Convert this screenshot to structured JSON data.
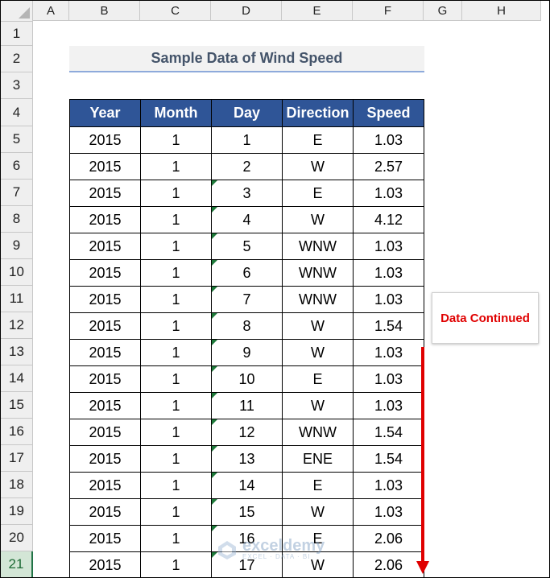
{
  "columns": [
    "A",
    "B",
    "C",
    "D",
    "E",
    "F",
    "G",
    "H"
  ],
  "rows": [
    "1",
    "2",
    "3",
    "4",
    "5",
    "6",
    "7",
    "8",
    "9",
    "10",
    "11",
    "12",
    "13",
    "14",
    "15",
    "16",
    "17",
    "18",
    "19",
    "20",
    "21"
  ],
  "active_row": "21",
  "title": "Sample Data of Wind Speed",
  "table": {
    "headers": [
      "Year",
      "Month",
      "Day",
      "Direction",
      "Speed"
    ],
    "rows": [
      [
        "2015",
        "1",
        "1",
        "E",
        "1.03"
      ],
      [
        "2015",
        "1",
        "2",
        "W",
        "2.57"
      ],
      [
        "2015",
        "1",
        "3",
        "E",
        "1.03"
      ],
      [
        "2015",
        "1",
        "4",
        "W",
        "4.12"
      ],
      [
        "2015",
        "1",
        "5",
        "WNW",
        "1.03"
      ],
      [
        "2015",
        "1",
        "6",
        "WNW",
        "1.03"
      ],
      [
        "2015",
        "1",
        "7",
        "WNW",
        "1.03"
      ],
      [
        "2015",
        "1",
        "8",
        "W",
        "1.54"
      ],
      [
        "2015",
        "1",
        "9",
        "W",
        "1.03"
      ],
      [
        "2015",
        "1",
        "10",
        "E",
        "1.03"
      ],
      [
        "2015",
        "1",
        "11",
        "W",
        "1.03"
      ],
      [
        "2015",
        "1",
        "12",
        "WNW",
        "1.54"
      ],
      [
        "2015",
        "1",
        "13",
        "ENE",
        "1.54"
      ],
      [
        "2015",
        "1",
        "14",
        "E",
        "1.03"
      ],
      [
        "2015",
        "1",
        "15",
        "W",
        "1.03"
      ],
      [
        "2015",
        "1",
        "16",
        "E",
        "2.06"
      ],
      [
        "2015",
        "1",
        "17",
        "W",
        "2.06"
      ]
    ]
  },
  "button": {
    "label": "Data Continued"
  },
  "watermark": {
    "name": "exceldemy",
    "tagline": "EXCEL · DATA · BI"
  },
  "colors": {
    "header_fill": "#2f5597",
    "accent_red": "#e00000",
    "title_text": "#44546a",
    "error_indicator": "#1e7a3a"
  }
}
